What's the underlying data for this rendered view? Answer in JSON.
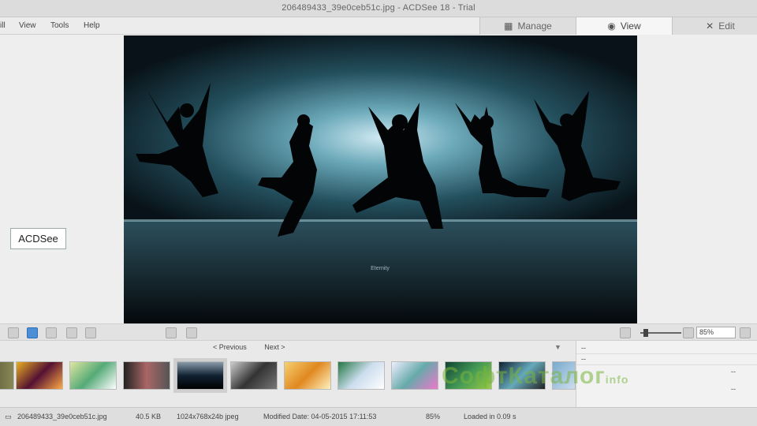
{
  "window": {
    "title": "206489433_39e0ceb51c.jpg - ACDSee 18 - Trial"
  },
  "menu": {
    "items": [
      "ill",
      "View",
      "Tools",
      "Help"
    ]
  },
  "modes": [
    {
      "label": "Manage",
      "icon": "grid-icon"
    },
    {
      "label": "View",
      "icon": "eye-icon"
    },
    {
      "label": "Edit",
      "icon": "edit-icon"
    }
  ],
  "overlay": {
    "label": "ACDSee"
  },
  "image": {
    "caption": "Eternity"
  },
  "toolbar": {
    "zoom": "85%"
  },
  "filmstrip": {
    "previous": "< Previous",
    "next": "Next >",
    "thumb_count": 11,
    "selected_index": 3
  },
  "properties": {
    "rows": [
      "--",
      "--",
      "--",
      "--"
    ]
  },
  "watermark": {
    "text": "СофтКаталог",
    "suffix": "info"
  },
  "status": {
    "filename": "206489433_39e0ceb51c.jpg",
    "size": "40.5 KB",
    "dims": "1024x768x24b jpeg",
    "modified": "Modified Date: 04-05-2015 17:11:53",
    "zoom": "85%",
    "loaded": "Loaded in 0.09 s"
  }
}
